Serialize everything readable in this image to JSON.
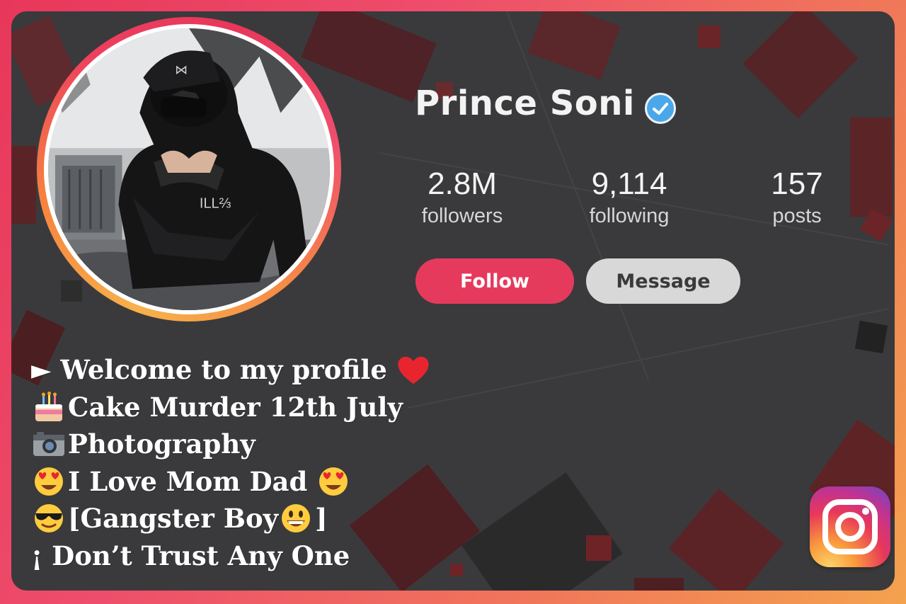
{
  "profile": {
    "name": "Prince Soni",
    "verified_badge": "verified-check-icon"
  },
  "stats": [
    {
      "value": "2.8M",
      "label": "followers"
    },
    {
      "value": "9,114",
      "label": "following"
    },
    {
      "value": "157",
      "label": "posts"
    }
  ],
  "actions": {
    "follow_label": "Follow",
    "message_label": "Message"
  },
  "bio": {
    "line1": "► Welcome to my profile",
    "line1_emoji": "red-heart-icon",
    "line2": "Cake Murder 12th July",
    "line2_emoji": "birthday-cake-icon",
    "line3": "Photography",
    "line3_emoji": "camera-icon",
    "line4": "I Love Mom Dad",
    "line4_emoji": "heart-eyes-face-icon",
    "line5": "[Gangster Boy",
    "line5_end": "]",
    "line5_emoji": "sunglasses-face-icon",
    "line6": "¡ Don’t Trust Any One"
  },
  "colors": {
    "follow": "#e63a5c",
    "message": "#d8d8d8",
    "verified": "#4aa8ea",
    "card": "#3a3a3c"
  }
}
